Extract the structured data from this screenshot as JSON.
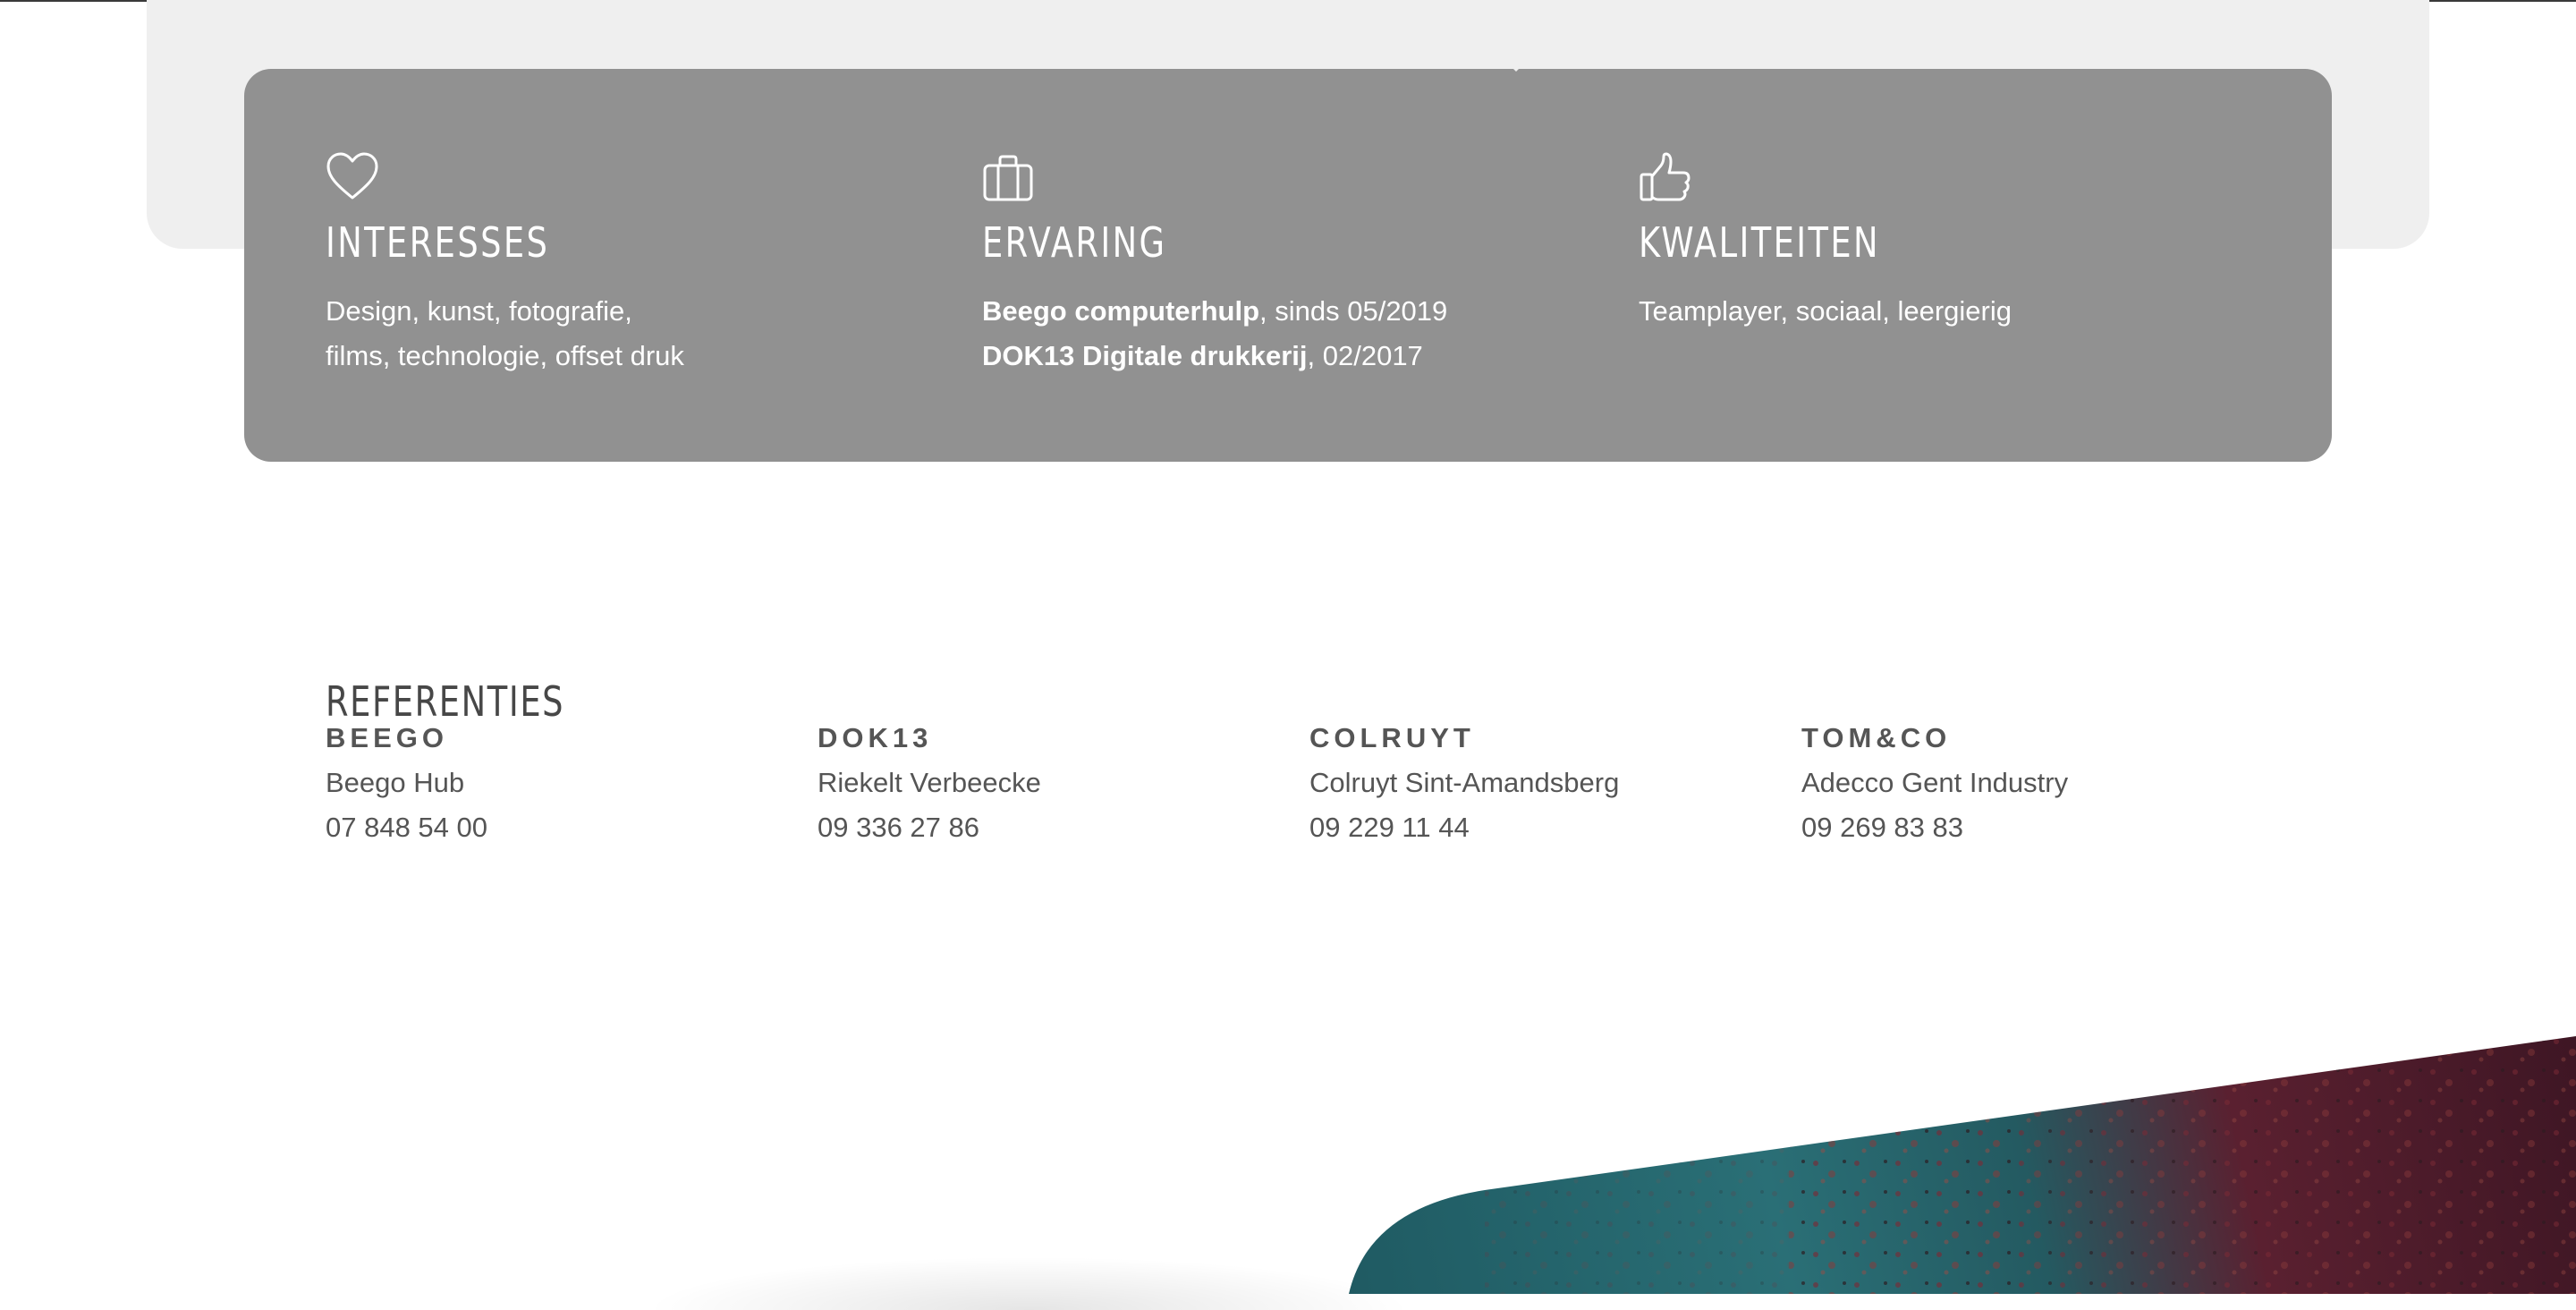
{
  "info_card": {
    "columns": [
      {
        "icon": "heart-icon",
        "title": "INTERESSES",
        "lines": [
          "Design, kunst, fotografie,",
          "films, technologie, offset druk"
        ]
      },
      {
        "icon": "briefcase-icon",
        "title": "ERVARING",
        "lines": [
          {
            "bold": "Beego computerhulp",
            "rest": ", sinds 05/2019"
          },
          {
            "bold": "DOK13 Digitale drukkerij",
            "rest": ", 02/2017"
          }
        ]
      },
      {
        "icon": "thumbs-up-icon",
        "title": "KWALITEITEN",
        "lines": [
          "Teamplayer, sociaal, leergierig"
        ]
      }
    ]
  },
  "references": {
    "title": "REFERENTIES",
    "items": [
      {
        "name": "BEEGO",
        "contact": "Beego Hub",
        "phone": "07 848 54 00"
      },
      {
        "name": "DOK13",
        "contact": "Riekelt Verbeecke",
        "phone": "09 336 27 86"
      },
      {
        "name": "COLRUYT",
        "contact": "Colruyt Sint-Amandsberg",
        "phone": "09 229 11 44"
      },
      {
        "name": "TOM&CO",
        "contact": "Adecco Gent Industry",
        "phone": "09 269 83 83"
      }
    ]
  },
  "colors": {
    "card_background": "#919191",
    "band_background": "#efefef",
    "heading_text": "#474747",
    "body_text": "#555555",
    "photo_teal": "#1f5a62",
    "photo_maroon": "#4a1a2a"
  }
}
